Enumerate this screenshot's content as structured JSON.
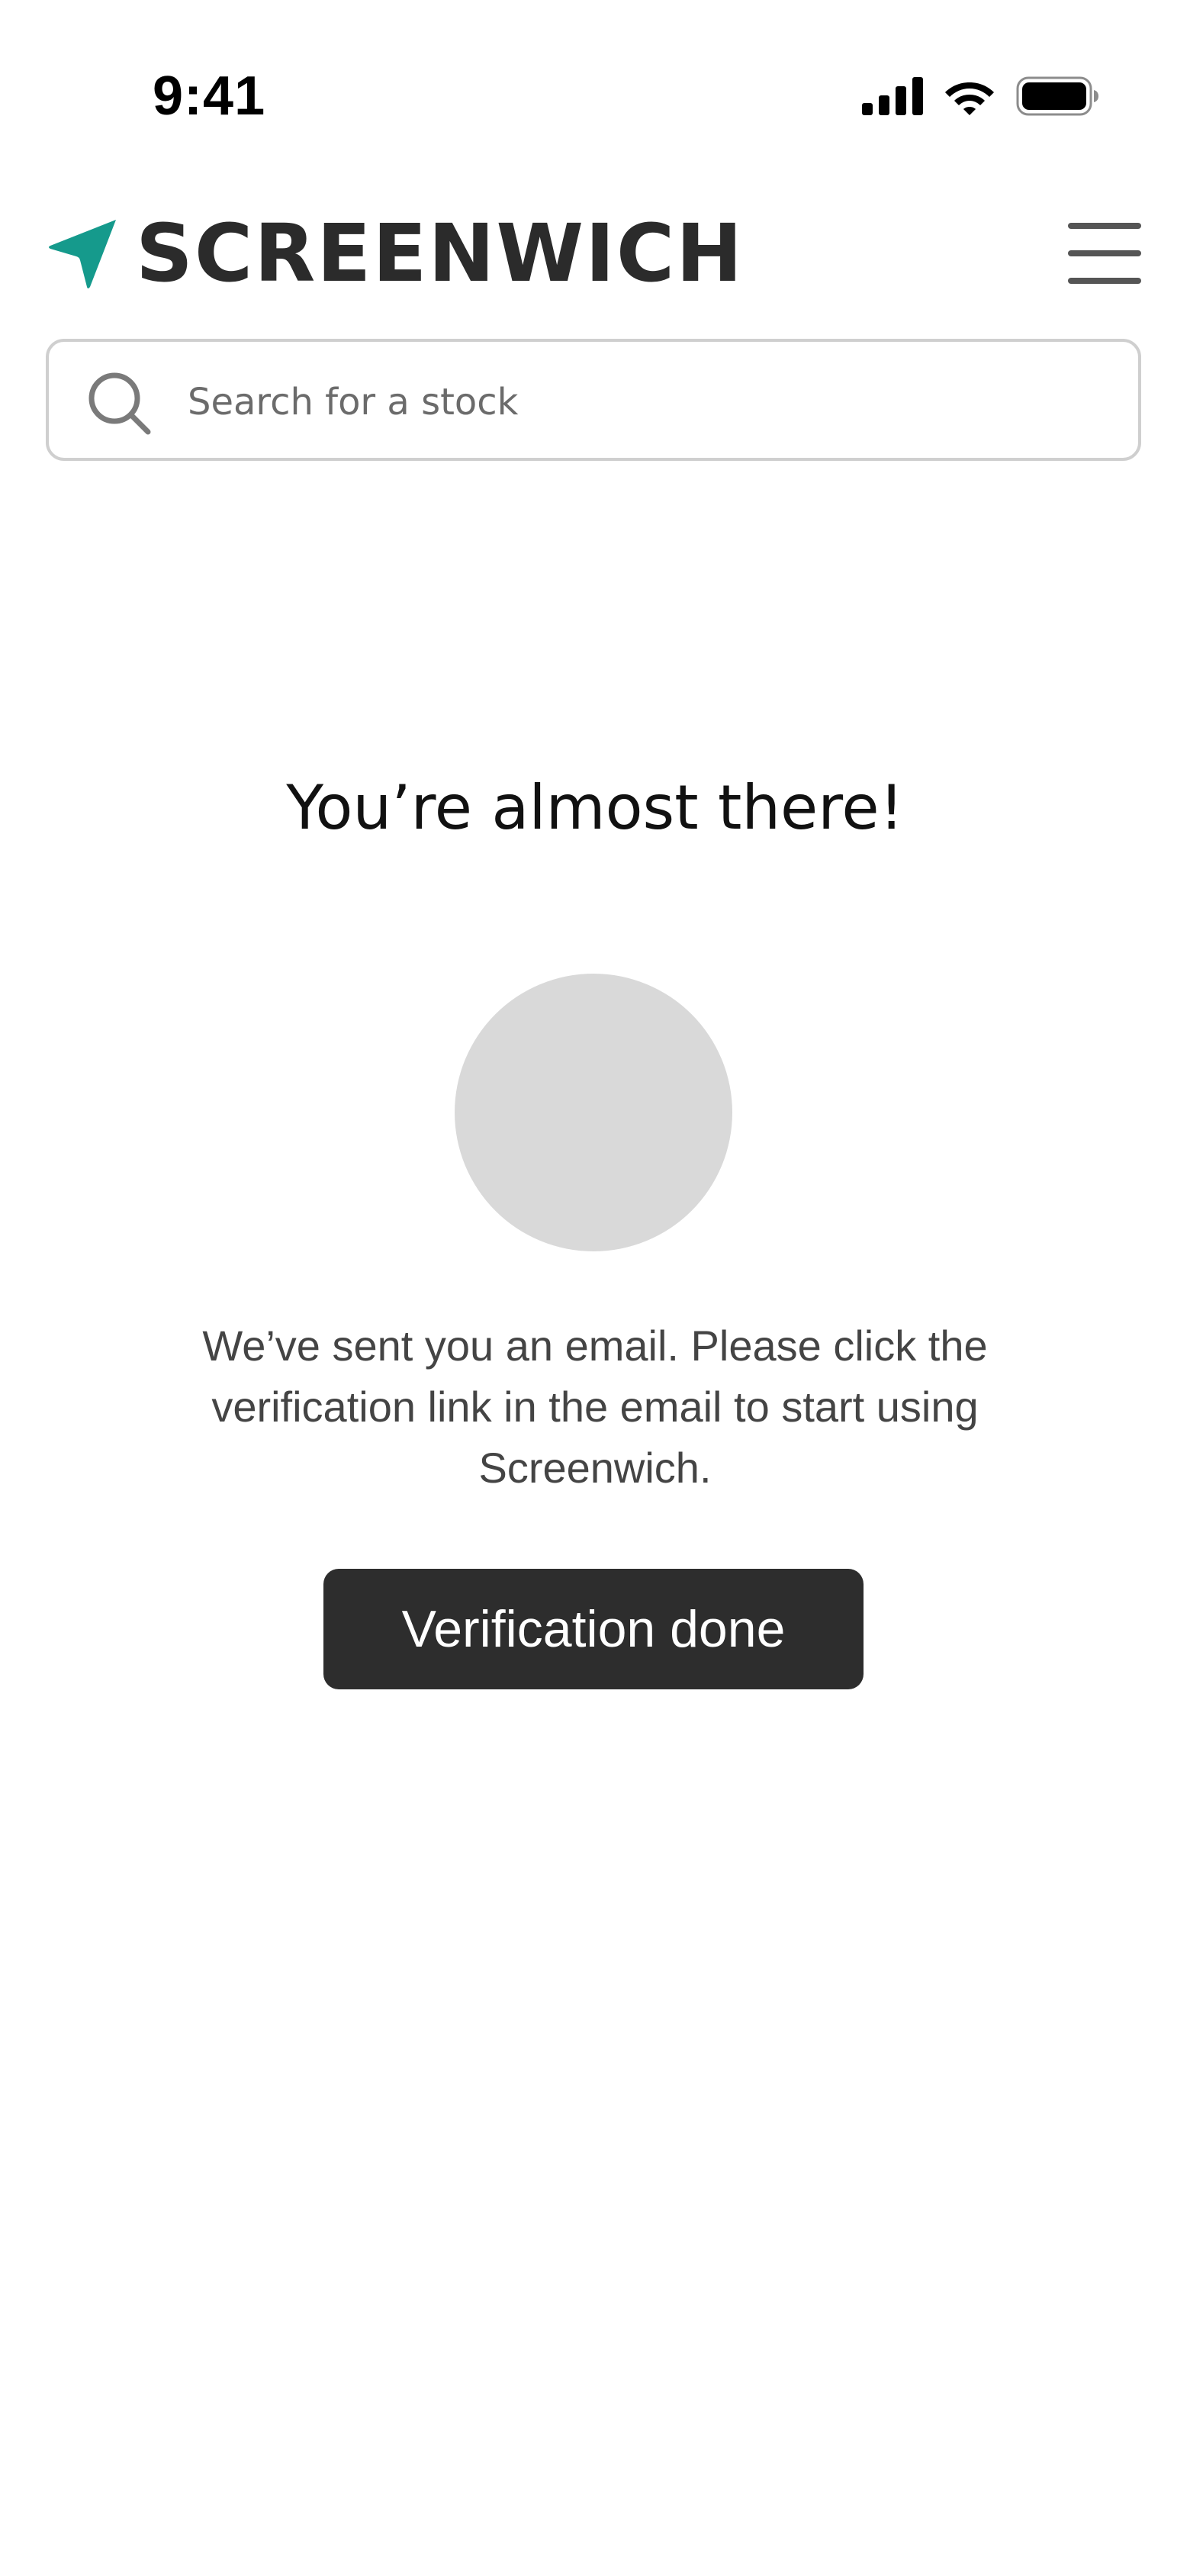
{
  "status_bar": {
    "time": "9:41"
  },
  "header": {
    "brand": "SCREENWICH",
    "logo_icon": "navigation-arrow-icon",
    "menu_icon": "hamburger-menu-icon"
  },
  "search": {
    "placeholder": "Search for a stock",
    "value": "",
    "icon": "search-icon"
  },
  "main": {
    "heading": "You’re almost there!",
    "message": "We’ve sent you an email. Please click the verification link in the email to start using Screenwich.",
    "button_label": "Verification done"
  },
  "colors": {
    "accent": "#159a8c",
    "brand_text": "#2b2b2b",
    "button_bg": "#2d2d2d",
    "circle_placeholder": "#d9d9d9",
    "border": "#cfcfcf"
  }
}
